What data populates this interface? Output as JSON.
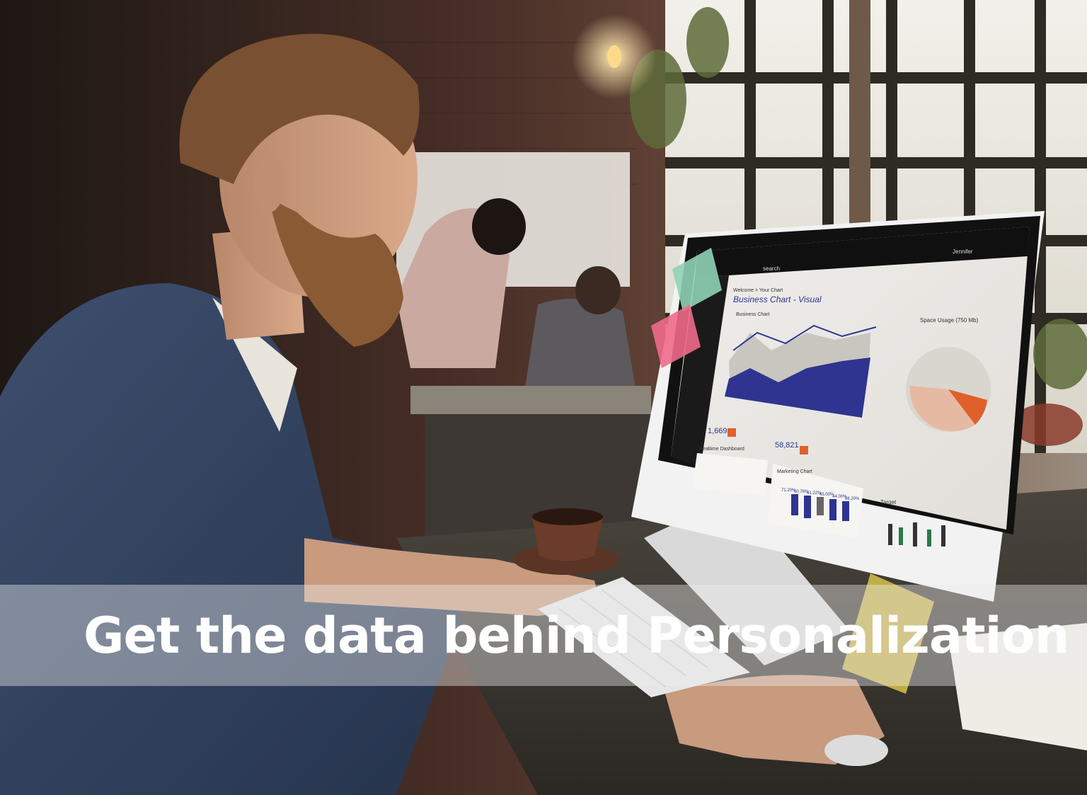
{
  "caption": {
    "headline": "Get the data behind Personalization"
  },
  "monitor_dashboard": {
    "search_label": "search",
    "user_name": "Jennifer",
    "breadcrumb": "Welcome > Your Chart",
    "page_title": "Business Chart - Visual",
    "business_chart_label": "Business Chart",
    "space_usage_title": "Space Usage (750 Mb)",
    "realtime_dashboard_label": "Realtime Dashboard",
    "marketing_chart_label": "Marketing Chart",
    "target_label": "Target",
    "stat_value_1": "1,669",
    "stat_value_2": "58,821",
    "marketing_percents": [
      "71.20%",
      "60.78%",
      "41.22%",
      "45.00%",
      "44.00%",
      "86.20%"
    ]
  },
  "colors": {
    "caption_text": "#ffffff",
    "caption_band": "#ececec",
    "dashboard_navy": "#2e3490",
    "dashboard_grey": "#c9c6bf",
    "accent_orange": "#e0602a"
  }
}
